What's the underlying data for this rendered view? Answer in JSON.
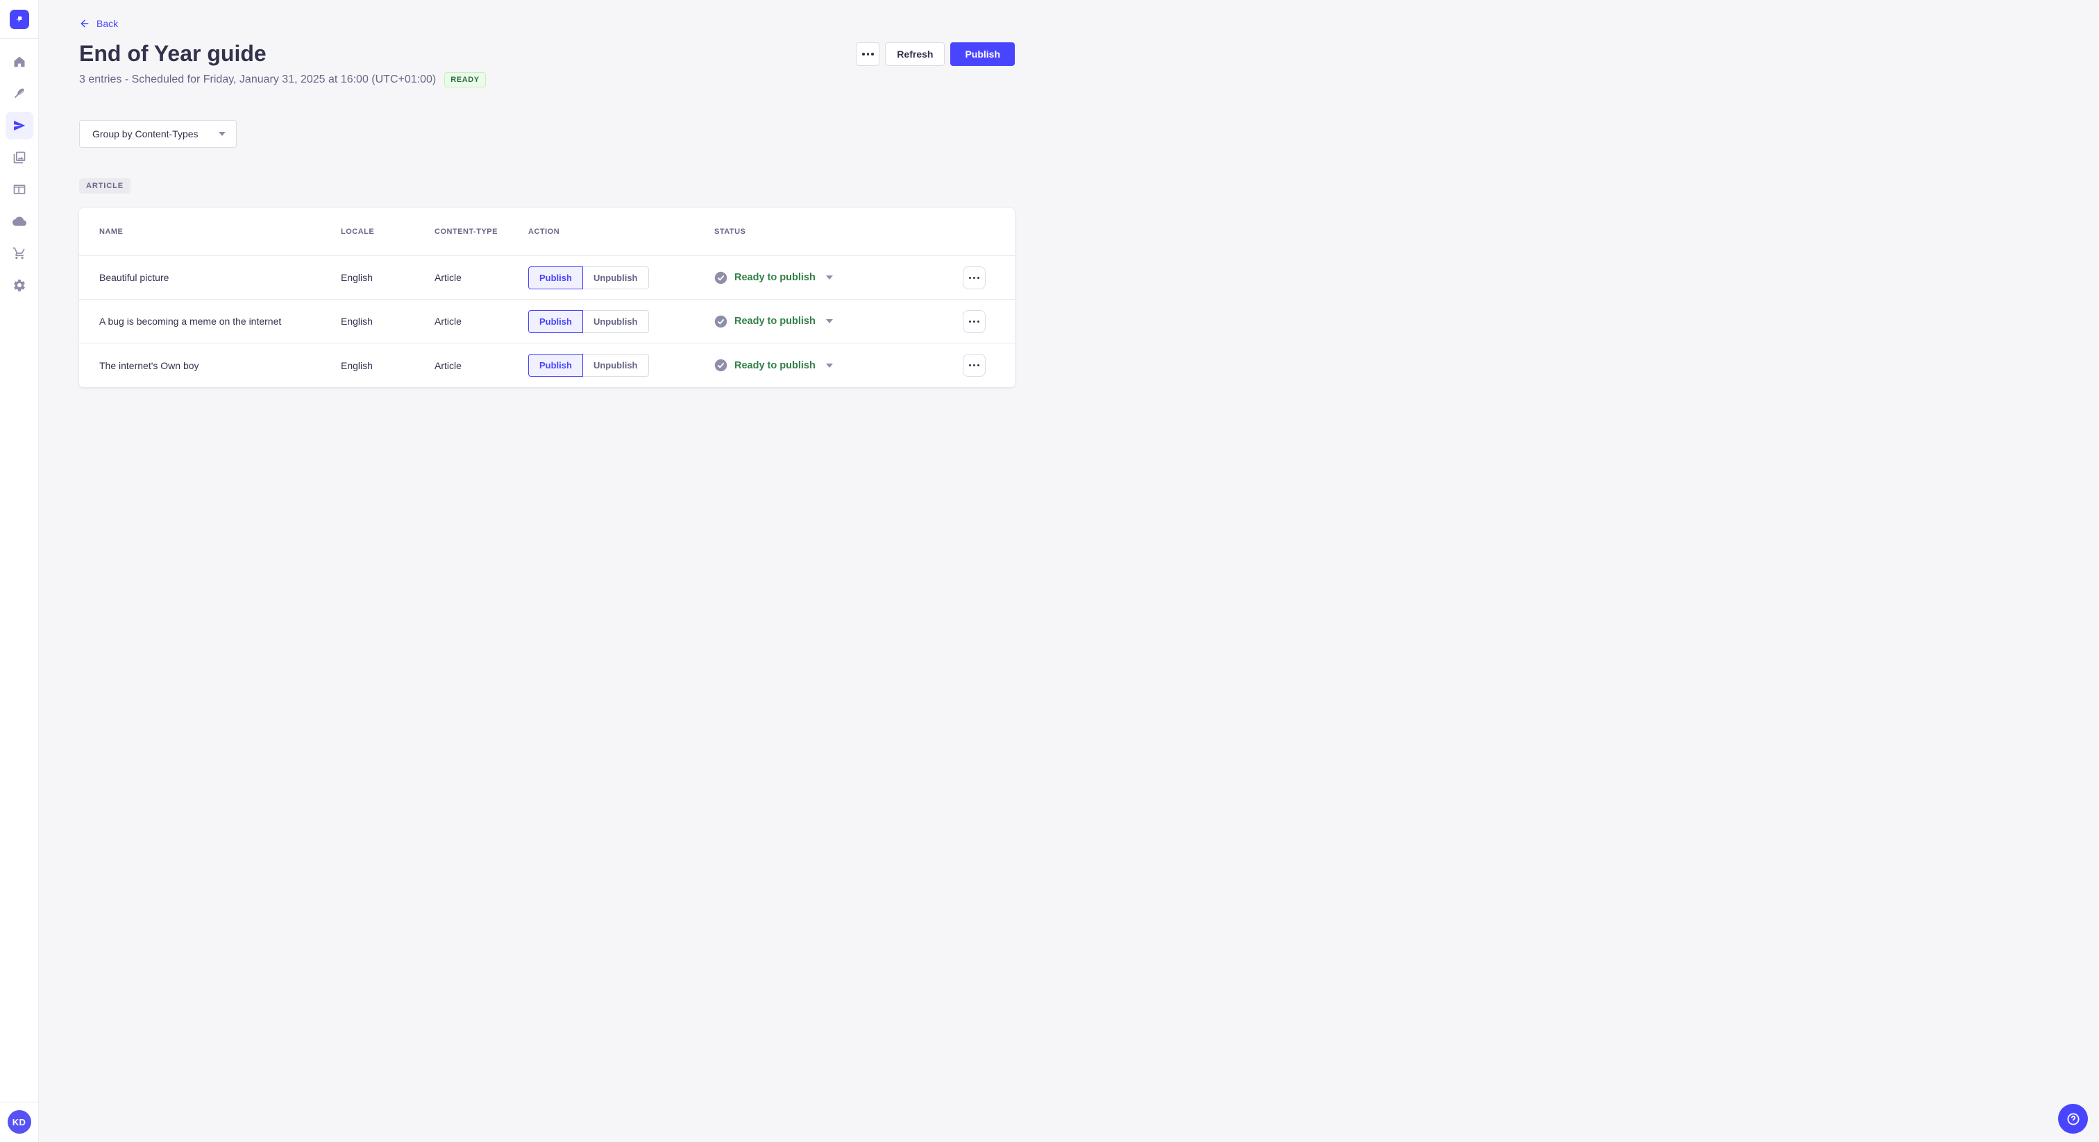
{
  "app": {
    "logo_icon": "strapi-logo",
    "brand_color": "#4945FF"
  },
  "sidebar": {
    "nav_icons": [
      "home-icon",
      "feather-icon",
      "paper-plane-icon",
      "images-icon",
      "layout-icon",
      "cloud-icon",
      "cart-icon",
      "gear-icon"
    ],
    "active_icon": "paper-plane-icon",
    "avatar_initials": "KD"
  },
  "header": {
    "back_label": "Back",
    "title": "End of Year guide",
    "subtitle": "3 entries - Scheduled for Friday, January 31, 2025 at 16:00 (UTC+01:00)",
    "release_status_badge": "READY",
    "more_button_icon": "ellipsis-icon",
    "refresh_label": "Refresh",
    "publish_label": "Publish"
  },
  "filters": {
    "group_by_label": "Group by Content-Types"
  },
  "group": {
    "content_type_badge": "ARTICLE"
  },
  "table": {
    "headers": [
      "NAME",
      "LOCALE",
      "CONTENT-TYPE",
      "ACTION",
      "STATUS"
    ],
    "action_labels": {
      "publish": "Publish",
      "unpublish": "Unpublish"
    },
    "rows": [
      {
        "name": "Beautiful picture",
        "locale": "English",
        "content_type": "Article",
        "selected_action": "Publish",
        "status": "Ready to publish"
      },
      {
        "name": "A bug is becoming a meme on the internet",
        "locale": "English",
        "content_type": "Article",
        "selected_action": "Publish",
        "status": "Ready to publish"
      },
      {
        "name": "The internet's Own boy",
        "locale": "English",
        "content_type": "Article",
        "selected_action": "Publish",
        "status": "Ready to publish"
      }
    ]
  },
  "colors": {
    "primary": "#4945FF",
    "primary_light": "#F0F0FF",
    "success_text": "#328048",
    "success_badge_bg": "#EAFBE7",
    "success_badge_border": "#C6F0C2",
    "text": "#32324D",
    "text_muted": "#666687",
    "icon_gray": "#8E8EA9",
    "border": "#DCDCE4",
    "page_bg": "#F6F6F9"
  }
}
